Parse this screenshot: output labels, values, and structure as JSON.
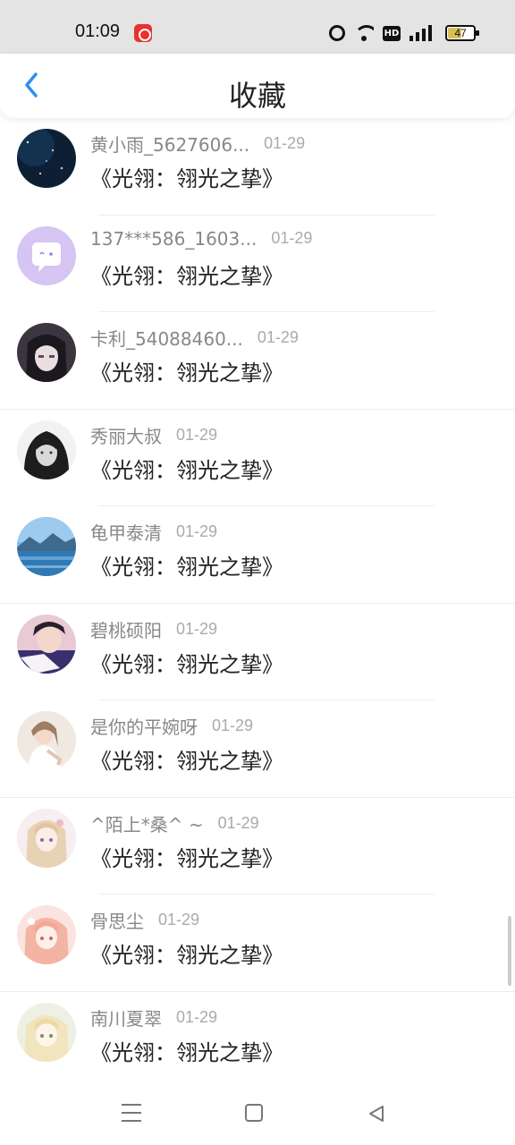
{
  "status_bar": {
    "time": "01:09",
    "battery": "47",
    "hd": "HD"
  },
  "header": {
    "title": "收藏"
  },
  "items": [
    {
      "username": "黄小雨_5627606...",
      "date": "01-29",
      "title": "《光翎：翎光之挚》",
      "avatar": "night-sky"
    },
    {
      "username": "137***586_1603...",
      "date": "01-29",
      "title": "《光翎：翎光之挚》",
      "avatar": "chat-bubble"
    },
    {
      "username": "卡利_54088460...",
      "date": "01-29",
      "title": "《光翎：翎光之挚》",
      "avatar": "anime-dark"
    },
    {
      "username": "秀丽大叔",
      "date": "01-29",
      "title": "《光翎：翎光之挚》",
      "avatar": "portrait-bw"
    },
    {
      "username": "龟甲泰清",
      "date": "01-29",
      "title": "《光翎：翎光之挚》",
      "avatar": "lake"
    },
    {
      "username": "碧桃硕阳",
      "date": "01-29",
      "title": "《光翎：翎光之挚》",
      "avatar": "photo-purple"
    },
    {
      "username": "是你的平婉呀",
      "date": "01-29",
      "title": "《光翎：翎光之挚》",
      "avatar": "girl-light"
    },
    {
      "username": "^陌上*桑^ ~",
      "date": "01-29",
      "title": "《光翎：翎光之挚》",
      "avatar": "anime-blonde"
    },
    {
      "username": "骨思尘",
      "date": "01-29",
      "title": "《光翎：翎光之挚》",
      "avatar": "anime-pink"
    },
    {
      "username": "南川夏翠",
      "date": "01-29",
      "title": "《光翎：翎光之挚》",
      "avatar": "anime-cream"
    }
  ],
  "colors": {
    "accent": "#2e8ef0",
    "username": "#888888",
    "title": "#222222"
  }
}
